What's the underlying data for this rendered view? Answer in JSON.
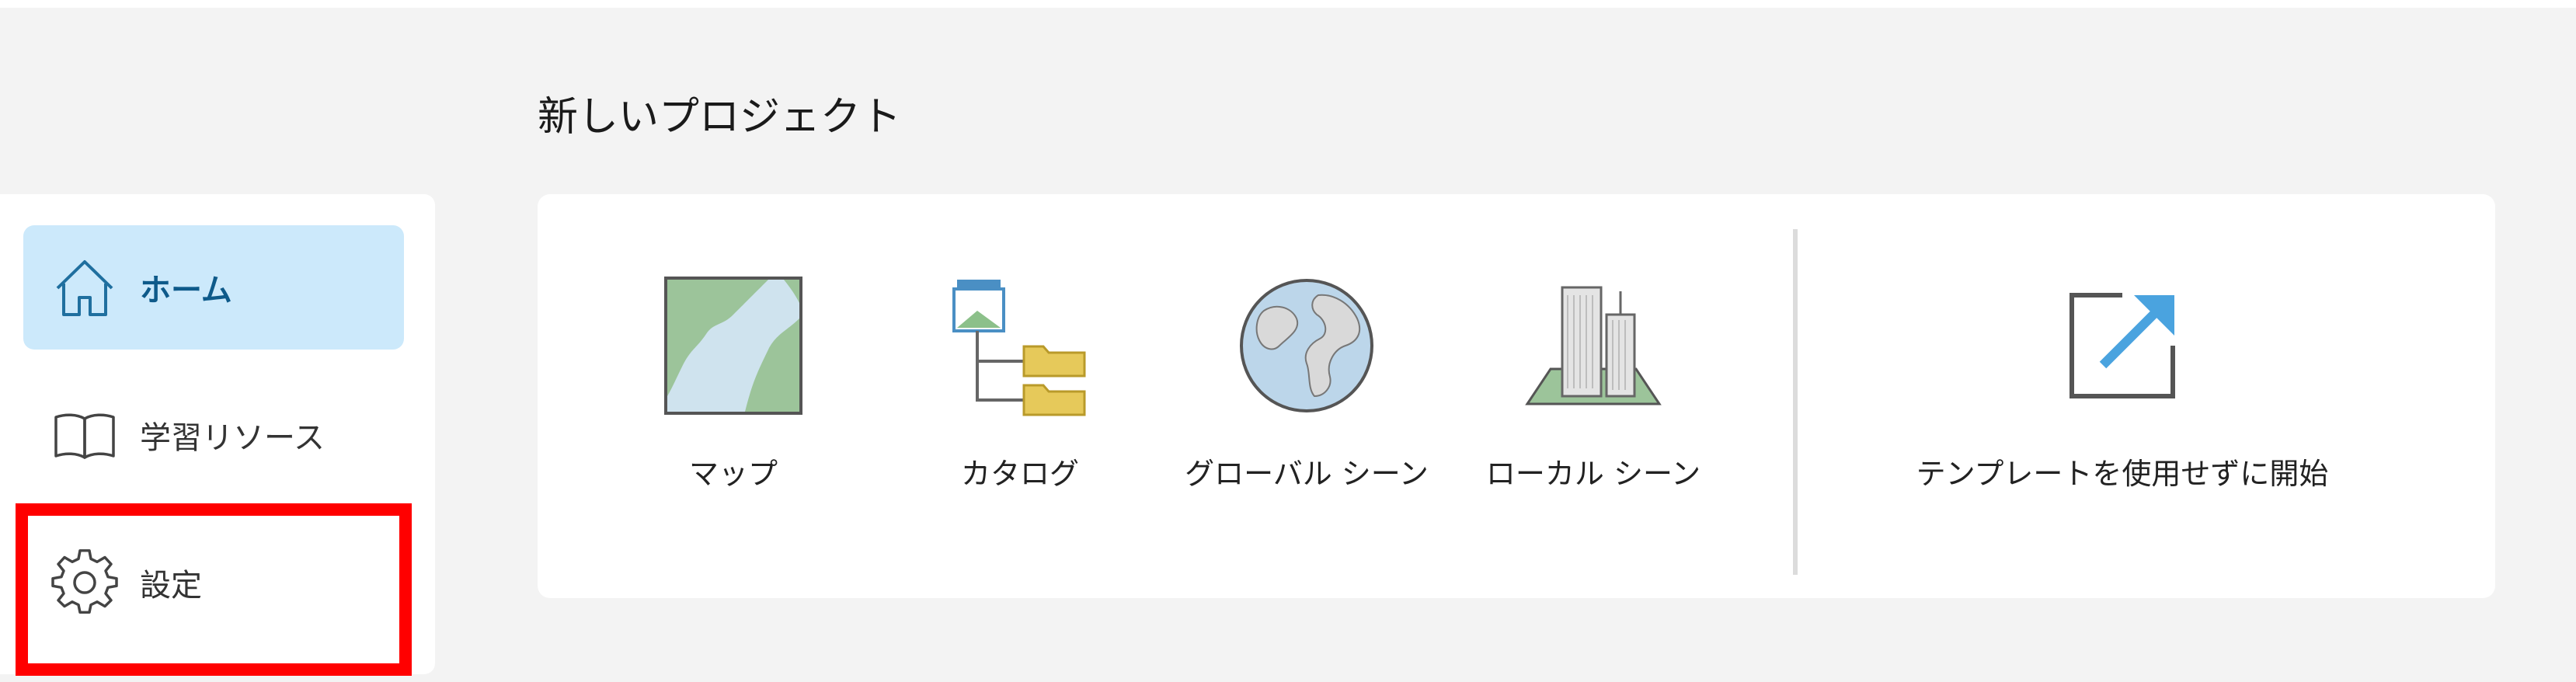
{
  "sidebar": {
    "items": [
      {
        "label": "ホーム",
        "icon": "home-icon"
      },
      {
        "label": "学習リソース",
        "icon": "book-icon"
      },
      {
        "label": "設定",
        "icon": "gear-icon"
      }
    ]
  },
  "new_project": {
    "title": "新しいプロジェクト",
    "templates": [
      {
        "label": "マップ",
        "icon": "map-icon"
      },
      {
        "label": "カタログ",
        "icon": "catalog-icon"
      },
      {
        "label": "グローバル シーン",
        "icon": "globe-icon"
      },
      {
        "label": "ローカル シーン",
        "icon": "local-scene-icon"
      }
    ],
    "blank": {
      "label": "テンプレートを使用せずに開始",
      "icon": "open-external-icon"
    }
  },
  "colors": {
    "home_highlight": "#cce9fb",
    "accent": "#4aa3df",
    "annotation": "#ff0000"
  }
}
